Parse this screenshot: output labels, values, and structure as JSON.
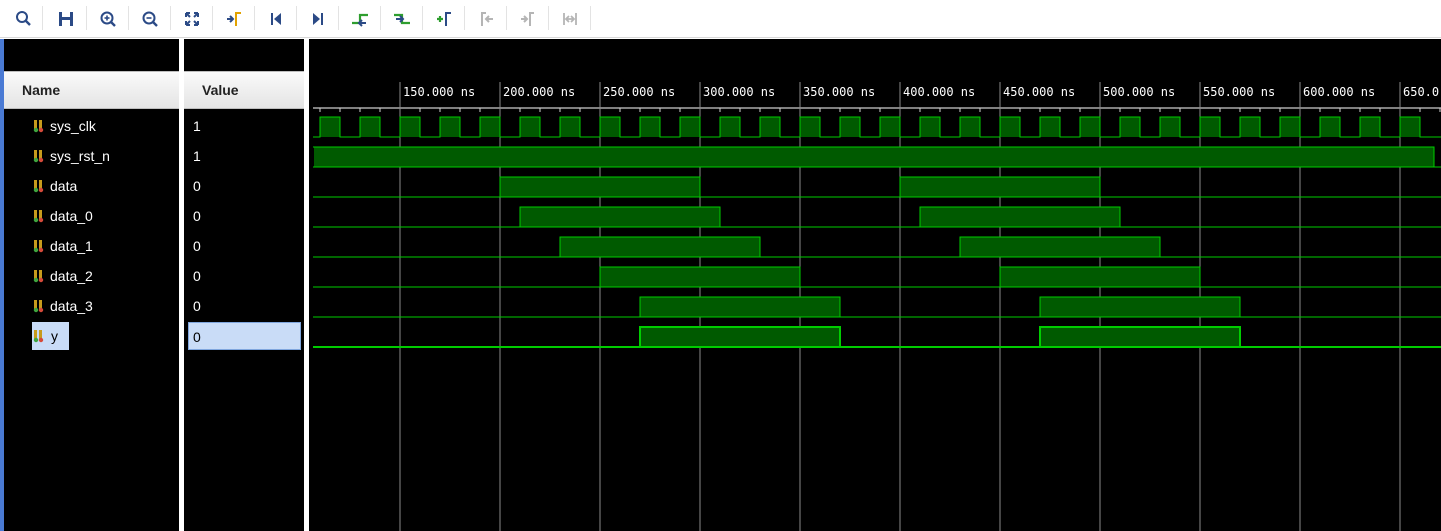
{
  "toolbar": {
    "buttons": [
      {
        "name": "search-icon"
      },
      {
        "name": "save-icon"
      },
      {
        "name": "zoom-in-icon"
      },
      {
        "name": "zoom-out-icon"
      },
      {
        "name": "zoom-fit-icon"
      },
      {
        "name": "go-to-cursor-icon"
      },
      {
        "name": "go-to-time-zero-icon"
      },
      {
        "name": "go-to-last-time-icon"
      },
      {
        "name": "previous-transition-icon"
      },
      {
        "name": "next-transition-icon"
      },
      {
        "name": "add-marker-icon"
      },
      {
        "name": "previous-marker-icon"
      },
      {
        "name": "next-marker-icon"
      },
      {
        "name": "swap-cursors-icon"
      }
    ]
  },
  "headers": {
    "name": "Name",
    "value": "Value"
  },
  "timeline": {
    "ticks": [
      "150.000 ns",
      "200.000 ns",
      "250.000 ns",
      "300.000 ns",
      "350.000 ns",
      "400.000 ns",
      "450.000 ns",
      "500.000 ns",
      "550.000 ns",
      "600.000 ns",
      "650.0"
    ],
    "tick_times_ns": [
      150,
      200,
      250,
      300,
      350,
      400,
      450,
      500,
      550,
      600,
      650
    ],
    "time_window_ns": [
      107,
      667
    ],
    "wave_color": "#00cc00",
    "fill_color": "#005a00"
  },
  "signals": [
    {
      "name": "sys_clk",
      "value": "1",
      "clock": {
        "period_ns": 20,
        "first_rise_ns": 110,
        "start_high": false
      }
    },
    {
      "name": "sys_rst_n",
      "value": "1",
      "high": [
        [
          107,
          667
        ]
      ]
    },
    {
      "name": "data",
      "value": "0",
      "high": [
        [
          200,
          300
        ],
        [
          400,
          500
        ]
      ]
    },
    {
      "name": "data_0",
      "value": "0",
      "high": [
        [
          210,
          310
        ],
        [
          410,
          510
        ]
      ]
    },
    {
      "name": "data_1",
      "value": "0",
      "high": [
        [
          230,
          330
        ],
        [
          430,
          530
        ]
      ]
    },
    {
      "name": "data_2",
      "value": "0",
      "high": [
        [
          250,
          350
        ],
        [
          450,
          550
        ]
      ]
    },
    {
      "name": "data_3",
      "value": "0",
      "high": [
        [
          270,
          370
        ],
        [
          470,
          570
        ]
      ]
    },
    {
      "name": "y",
      "value": "0",
      "high": [
        [
          270,
          370
        ],
        [
          470,
          570
        ]
      ],
      "selected": true
    }
  ]
}
